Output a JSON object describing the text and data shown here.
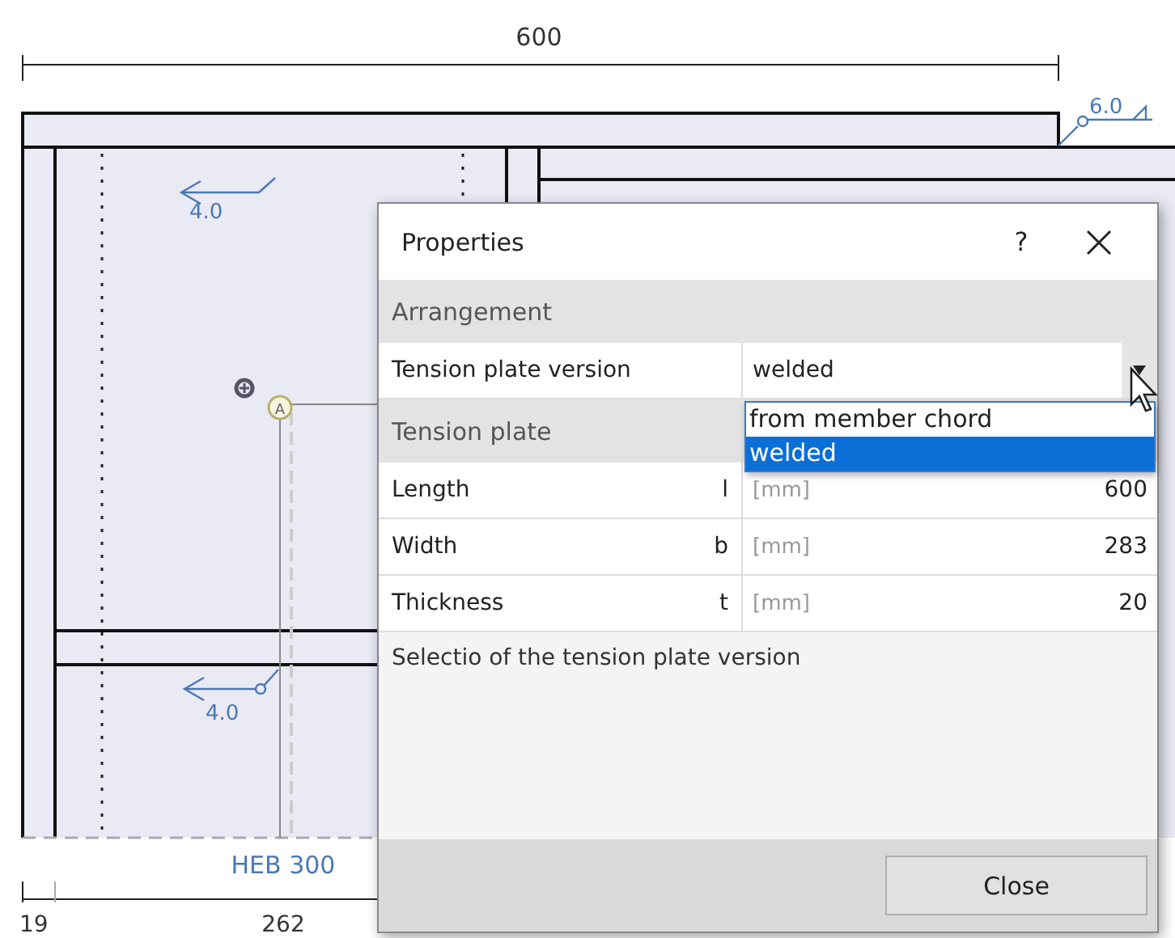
{
  "drawing": {
    "top_dimension": "600",
    "weld_labels": [
      "6.0",
      "4.0",
      "4.0"
    ],
    "profile": "HEB 300",
    "bottom_dimensions": [
      "19",
      "262"
    ],
    "node_label": "A"
  },
  "dialog": {
    "title": "Properties",
    "help": "?",
    "sections": [
      {
        "heading": "Arrangement",
        "rows": [
          {
            "kind": "combo",
            "label": "Tension plate version",
            "value": "welded",
            "expanded": true,
            "options": [
              {
                "label": "from member chord",
                "selected": false
              },
              {
                "label": "welded",
                "selected": true
              }
            ]
          }
        ]
      },
      {
        "heading": "Tension plate",
        "rows": [
          {
            "kind": "number",
            "label": "Length",
            "symbol": "l",
            "unit": "[mm]",
            "value": "600"
          },
          {
            "kind": "number",
            "label": "Width",
            "symbol": "b",
            "unit": "[mm]",
            "value": "283"
          },
          {
            "kind": "number",
            "label": "Thickness",
            "symbol": "t",
            "unit": "[mm]",
            "value": "20"
          }
        ]
      }
    ],
    "description": "Selectio of the tension plate version",
    "close_button": "Close"
  }
}
